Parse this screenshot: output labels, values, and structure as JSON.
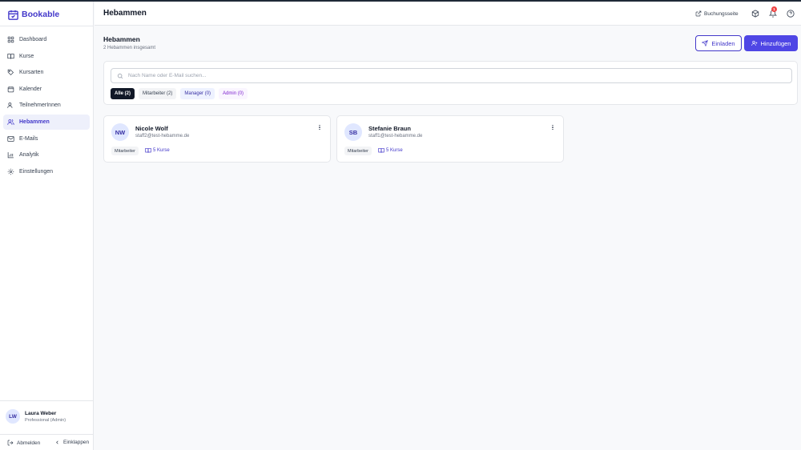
{
  "app": {
    "name": "Bookable",
    "accent": "#4f46e5"
  },
  "sidebar": {
    "items": [
      {
        "label": "Dashboard",
        "icon": "grid-icon"
      },
      {
        "label": "Kurse",
        "icon": "book-icon"
      },
      {
        "label": "Kursarten",
        "icon": "tag-icon"
      },
      {
        "label": "Kalender",
        "icon": "calendar-icon"
      },
      {
        "label": "TeilnehmerInnen",
        "icon": "users-icon"
      },
      {
        "label": "Hebammen",
        "icon": "user-group-icon",
        "active": true
      },
      {
        "label": "E-Mails",
        "icon": "mail-icon"
      },
      {
        "label": "Analytik",
        "icon": "bar-chart-icon"
      },
      {
        "label": "Einstellungen",
        "icon": "gear-icon"
      }
    ],
    "user": {
      "initials": "LW",
      "name": "Laura Weber",
      "role": "Professional (Admin)"
    },
    "logout_label": "Abmelden",
    "collapse_label": "Einklappen"
  },
  "header": {
    "title": "Hebammen",
    "booking_link": "Buchungsseite",
    "notification_count": "1"
  },
  "main": {
    "title": "Hebammen",
    "subtitle": "2 Hebammen insgesamt",
    "invite_label": "Einladen",
    "add_label": "Hinzufügen",
    "search_placeholder": "Nach Name oder E-Mail suchen...",
    "filters": [
      {
        "label": "Alle (2)",
        "selected": true
      },
      {
        "label": "Mitarbeiter (2)"
      },
      {
        "label": "Manager (0)"
      },
      {
        "label": "Admin (0)"
      }
    ],
    "midwives": [
      {
        "initials": "NW",
        "name": "Nicole Wolf",
        "email": "staff2@test-hebamme.de",
        "role": "Mitarbeiter",
        "courses": "5 Kurse"
      },
      {
        "initials": "SB",
        "name": "Stefanie Braun",
        "email": "staff1@test-hebamme.de",
        "role": "Mitarbeiter",
        "courses": "5 Kurse"
      }
    ]
  }
}
